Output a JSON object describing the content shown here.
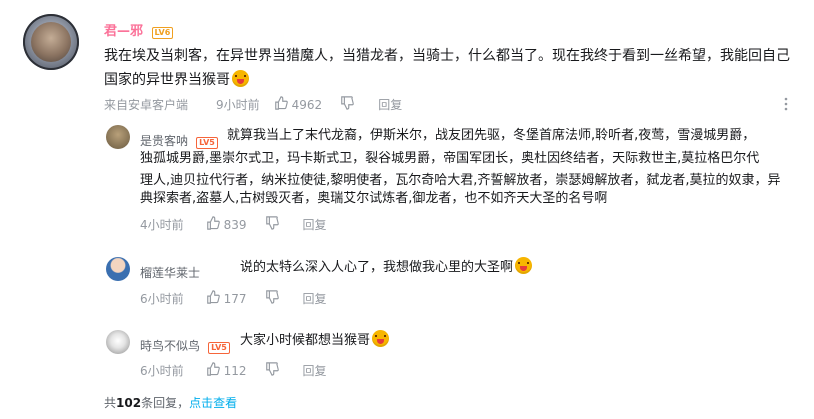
{
  "main_comment": {
    "username": "君—邪",
    "level": "LV6",
    "text": "我在埃及当刺客，在异世界当猎魔人，当猎龙者，当骑士，什么都当了。现在我终于看到一丝希望，我能回自己国家的异世界当猴哥",
    "source": "来自安卓客户端",
    "time": "9小时前",
    "likes": "4962",
    "reply_label": "回复"
  },
  "replies": [
    {
      "username": "是贵客呐",
      "level": "LV5",
      "lines": [
        "就算我当上了末代龙裔，伊斯米尔，战友团先驱，冬堡首席法师,聆听者,夜莺，雪漫城男爵，",
        "独孤城男爵,墨崇尔式卫，玛卡斯式卫，裂谷城男爵，帝国军团长，奥杜因终结者，天际救世主,莫拉格巴尔代",
        "理人,迪贝拉代行者，纳米拉使徒,黎明使者，瓦尔奇哈大君,齐誓解放者，崇瑟姆解放者，弑龙者,莫拉的奴隶，异",
        "典探索者,盗墓人,古树毁灭者，奥瑞艾尔试炼者,御龙者，也不如齐天大圣的名号啊"
      ],
      "time": "4小时前",
      "likes": "839",
      "reply_label": "回复"
    },
    {
      "username": "榴莲华莱士",
      "level": "",
      "text": "说的太特么深入人心了，我想做我心里的大圣啊",
      "time": "6小时前",
      "likes": "177",
      "reply_label": "回复"
    },
    {
      "username": "時鸟不似鸟",
      "level": "LV5",
      "text": "大家小时候都想当猴哥",
      "time": "6小时前",
      "likes": "112",
      "reply_label": "回复"
    }
  ],
  "footer": {
    "prefix": "共",
    "count": "102",
    "suffix": "条回复，",
    "link": "点击查看"
  },
  "icons": {
    "like": "thumbs-up-icon",
    "dislike": "thumbs-down-icon",
    "more": "more-vertical-icon",
    "emoji": "crying-emoji"
  },
  "colors": {
    "vip_name": "#fb7299",
    "link": "#00aeec",
    "meta": "#9499a0"
  }
}
